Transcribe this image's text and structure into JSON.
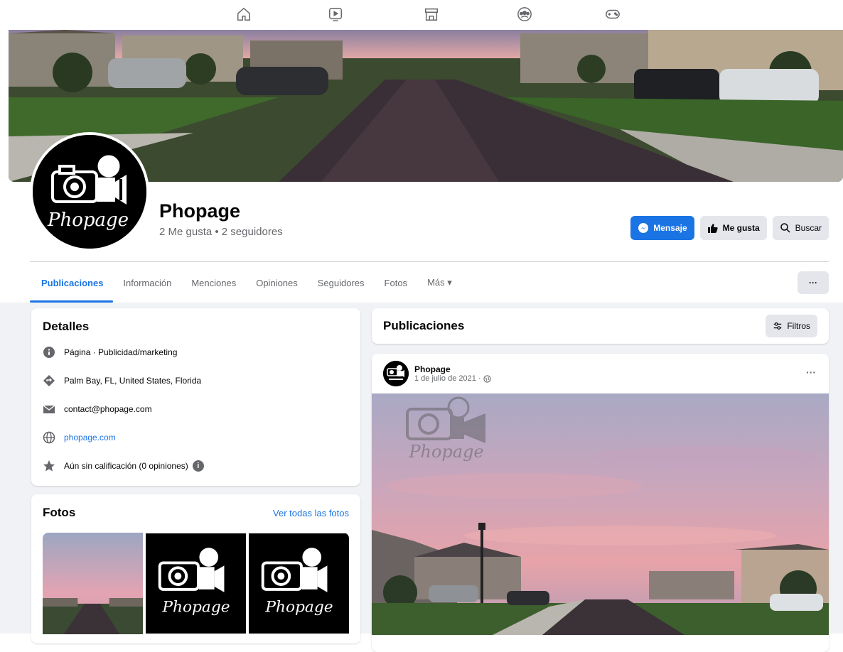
{
  "topnav": {
    "icons": [
      "home-icon",
      "watch-icon",
      "marketplace-icon",
      "groups-icon",
      "gaming-icon"
    ]
  },
  "page": {
    "name": "Phopage",
    "stats": "2 Me gusta • 2 seguidores",
    "logo_text": "Phopage"
  },
  "actions": {
    "message": "Mensaje",
    "like": "Me gusta",
    "search": "Buscar"
  },
  "tabs": [
    "Publicaciones",
    "Información",
    "Menciones",
    "Opiniones",
    "Seguidores",
    "Fotos",
    "Más ▾"
  ],
  "more_button": "···",
  "details": {
    "title": "Detalles",
    "category": "Página · Publicidad/marketing",
    "location": "Palm Bay, FL, United States, Florida",
    "email": "contact@phopage.com",
    "website": "phopage.com",
    "rating": "Aún sin calificación (0 opiniones)"
  },
  "photos": {
    "title": "Fotos",
    "see_all": "Ver todas las fotos"
  },
  "publications": {
    "title": "Publicaciones",
    "filters": "Filtros"
  },
  "post": {
    "author": "Phopage",
    "date": "1 de julio de 2021 ·",
    "menu": "···",
    "watermark": "Phopage"
  },
  "colors": {
    "accent": "#1b74e4",
    "secondary_button": "#e4e6eb",
    "feed_background": "#f0f2f5",
    "muted_text": "#65676b"
  }
}
